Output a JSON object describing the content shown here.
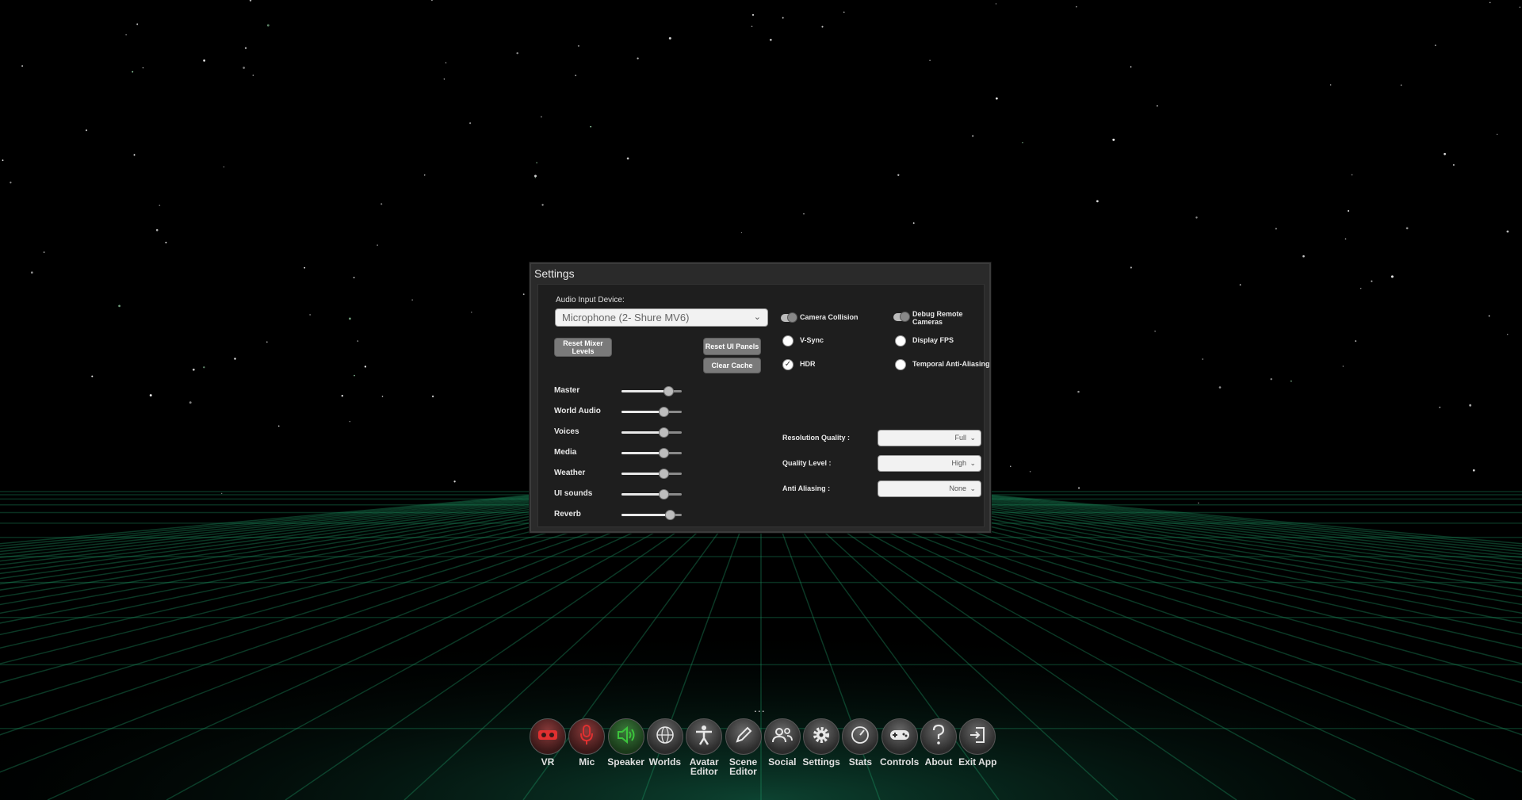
{
  "settings": {
    "title": "Settings",
    "audio_input_label": "Audio Input Device:",
    "audio_input_value": "Microphone (2- Shure MV6)",
    "reset_mixer_label": "Reset Mixer Levels",
    "reset_ui_label": "Reset UI Panels",
    "clear_cache_label": "Clear Cache",
    "sliders": [
      {
        "label": "Master",
        "level": 0.78
      },
      {
        "label": "World Audio",
        "level": 0.7
      },
      {
        "label": "Voices",
        "level": 0.7
      },
      {
        "label": "Media",
        "level": 0.7
      },
      {
        "label": "Weather",
        "level": 0.7
      },
      {
        "label": "UI sounds",
        "level": 0.7
      },
      {
        "label": "Reverb",
        "level": 0.8
      }
    ],
    "options": {
      "camera_collision": {
        "label": "Camera Collision",
        "enabled": true
      },
      "debug_remote_cameras": {
        "label": "Debug Remote Cameras",
        "enabled": true
      },
      "vsync": {
        "label": "V-Sync",
        "checked": false
      },
      "display_fps": {
        "label": "Display FPS",
        "checked": false
      },
      "hdr": {
        "label": "HDR",
        "checked": true
      },
      "temporal_aa": {
        "label": "Temporal Anti-Aliasing",
        "checked": false
      }
    },
    "dropdowns": {
      "resolution_quality": {
        "label": "Resolution Quality :",
        "value": "Full"
      },
      "quality_level": {
        "label": "Quality Level :",
        "value": "High"
      },
      "anti_aliasing": {
        "label": "Anti Aliasing :",
        "value": "None"
      }
    }
  },
  "dock": {
    "more": "...",
    "items": [
      {
        "label": "VR",
        "icon": "vr-headset-icon",
        "state": "off"
      },
      {
        "label": "Mic",
        "icon": "microphone-icon",
        "state": "off"
      },
      {
        "label": "Speaker",
        "icon": "speaker-icon",
        "state": "on"
      },
      {
        "label": "Worlds",
        "icon": "globe-icon"
      },
      {
        "label": "Avatar Editor",
        "icon": "avatar-icon"
      },
      {
        "label": "Scene Editor",
        "icon": "pencil-icon"
      },
      {
        "label": "Social",
        "icon": "people-icon"
      },
      {
        "label": "Settings",
        "icon": "gear-icon"
      },
      {
        "label": "Stats",
        "icon": "gauge-icon"
      },
      {
        "label": "Controls",
        "icon": "gamepad-icon"
      },
      {
        "label": "About",
        "icon": "question-icon"
      },
      {
        "label": "Exit App",
        "icon": "exit-icon"
      }
    ]
  },
  "colors": {
    "off": "#e03030",
    "on": "#3cc43c",
    "grid": "#1fa06a"
  }
}
